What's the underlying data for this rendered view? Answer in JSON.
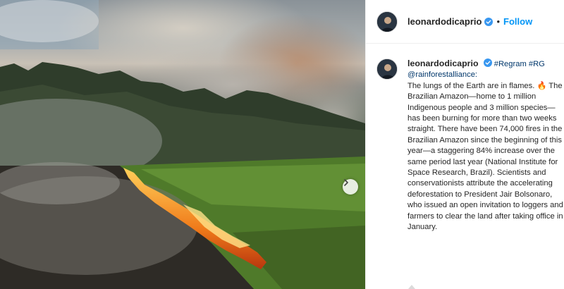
{
  "post": {
    "username": "leonardodicaprio",
    "follow_label": "Follow",
    "separator": "•",
    "tags": [
      "#Regram",
      "#RG",
      "@rainforestalliance:"
    ],
    "caption": "The lungs of the Earth are in flames. 🔥 The Brazilian Amazon—home to 1 million Indigenous people and 3 million species—has been burning for more than two weeks straight. There have been 74,000 fires in the Brazilian Amazon since the beginning of this year—a staggering 84% increase over the same period last year (National Institute for Space Research, Brazil). Scientists and conservationists attribute the accelerating deforestation to President Jair Bolsonaro, who issued an open invitation to loggers and farmers to clear the land after taking office in January."
  },
  "icons": {
    "verified": "verified-badge-icon",
    "next": "chevron-right-icon"
  },
  "colors": {
    "link_blue": "#0095f6",
    "hashtag": "#00376b",
    "text": "#262626",
    "verified": "#3897f0"
  }
}
